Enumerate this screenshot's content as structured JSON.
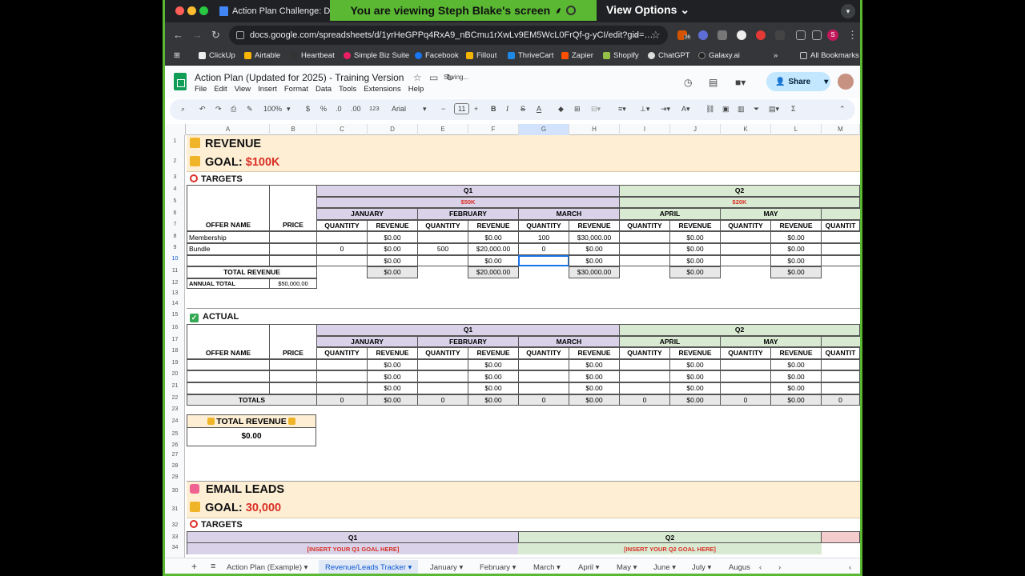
{
  "browser": {
    "tab_title": "Action Plan Challenge: Dec",
    "share_banner": "You are viewing  Steph Blake's screen",
    "view_options": "View Options",
    "url": "docs.google.com/spreadsheets/d/1yrHeGPPq4RxA9_nBCmu1rXwLv9EM5WcL0FrQf-g-yCI/edit?gid=…",
    "extension_badge": "26",
    "profile_initial": "S",
    "bookmarks": [
      "ClickUp",
      "Airtable",
      "Heartbeat",
      "Simple Biz Suite",
      "Facebook",
      "Fillout",
      "ThriveCart",
      "Zapier",
      "Shopify",
      "ChatGPT",
      "Galaxy.ai"
    ],
    "all_bookmarks": "All Bookmarks"
  },
  "sheets": {
    "title": "Action Plan (Updated for 2025) - Training Version",
    "saving": "Saving...",
    "menu": [
      "File",
      "Edit",
      "View",
      "Insert",
      "Format",
      "Data",
      "Tools",
      "Extensions",
      "Help"
    ],
    "share_label": "Share",
    "toolbar": {
      "zoom": "100%",
      "currency": "$",
      "percent": "%",
      "dec_less": ".0",
      "dec_more": ".00",
      "format_num": "123",
      "font": "Arial",
      "font_size": "11"
    },
    "columns": [
      "A",
      "B",
      "C",
      "D",
      "E",
      "F",
      "G",
      "H",
      "I",
      "J",
      "K",
      "L",
      "M"
    ],
    "rows": [
      "1",
      "2",
      "3",
      "4",
      "5",
      "6",
      "7",
      "8",
      "9",
      "10",
      "11",
      "12",
      "13",
      "14",
      "15",
      "16",
      "17",
      "18",
      "19",
      "20",
      "21",
      "22",
      "23",
      "24",
      "25",
      "26",
      "27",
      "28",
      "29",
      "30",
      "31",
      "32",
      "33",
      "34"
    ]
  },
  "revenue": {
    "heading": "REVENUE",
    "goal_label": "GOAL:",
    "goal_value": "$100K",
    "targets": "TARGETS",
    "q1": "Q1",
    "q1_goal": "$50K",
    "q2": "Q2",
    "q2_goal": "$20K",
    "months": [
      "JANUARY",
      "FEBRUARY",
      "MARCH",
      "APRIL",
      "MAY"
    ],
    "col_offer": "OFFER NAME",
    "col_price": "PRICE",
    "col_qty": "QUANTITY",
    "col_rev": "REVENUE",
    "col_qty_cut": "QUANTIT",
    "rows": [
      {
        "name": "Membership",
        "price": "",
        "cells": [
          "",
          "$0.00",
          "",
          "$0.00",
          "100",
          "$30,000.00",
          "",
          "$0.00",
          "",
          "$0.00"
        ]
      },
      {
        "name": "Bundle",
        "price": "",
        "cells": [
          "0",
          "$0.00",
          "500",
          "$20,000.00",
          "0",
          "$0.00",
          "",
          "$0.00",
          "",
          "$0.00"
        ]
      },
      {
        "name": "",
        "price": "",
        "cells": [
          "",
          "$0.00",
          "",
          "$0.00",
          "",
          "$0.00",
          "",
          "$0.00",
          "",
          "$0.00"
        ]
      }
    ],
    "total_revenue_label": "TOTAL REVENUE",
    "totals": [
      "$0.00",
      "$20,000.00",
      "$30,000.00",
      "$0.00",
      "$0.00"
    ],
    "annual_total_label": "ANNUAL TOTAL",
    "annual_total": "$50,000.00"
  },
  "actual": {
    "heading": "ACTUAL",
    "row_values": [
      "$0.00",
      "$0.00",
      "$0.00",
      "$0.00",
      "$0.00"
    ],
    "totals_label": "TOTALS",
    "totals": [
      "0",
      "$0.00",
      "0",
      "$0.00",
      "0",
      "$0.00",
      "0",
      "$0.00",
      "0",
      "$0.00",
      "0"
    ],
    "total_revenue_box_label": "TOTAL REVENUE",
    "total_revenue_box_value": "$0.00"
  },
  "email": {
    "heading": "EMAIL LEADS",
    "goal_label": "GOAL:",
    "goal_value": "30,000",
    "targets": "TARGETS",
    "q1": "Q1",
    "q2": "Q2",
    "q1_goal": "[INSERT YOUR Q1 GOAL HERE]",
    "q2_goal": "[INSERT YOUR Q2 GOAL HERE]"
  },
  "sheet_tabs": [
    "Action Plan (Example)",
    "Revenue/Leads Tracker",
    "January",
    "February",
    "March",
    "April",
    "May",
    "June",
    "July",
    "Augus"
  ]
}
